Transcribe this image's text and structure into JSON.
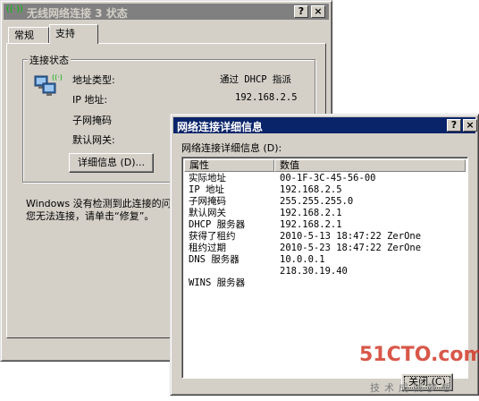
{
  "status_window": {
    "title": "无线网络连接 3 状态",
    "tabs": [
      "常规",
      "支持"
    ],
    "active_tab": "支持",
    "group_title": "连接状态",
    "fields": [
      {
        "label": "地址类型:",
        "value": "通过 DHCP 指派"
      },
      {
        "label": "IP 地址:",
        "value": "192.168.2.5"
      },
      {
        "label": "子网掩码",
        "value": ""
      },
      {
        "label": "默认网关:",
        "value": ""
      }
    ],
    "details_button": "详细信息 (D)...",
    "message_line1": "Windows 没有检测到此连接的问",
    "message_line2": "您无法连接，请单击“修复”。"
  },
  "details_dialog": {
    "title": "网络连接详细信息",
    "list_label": "网络连接详细信息 (D):",
    "columns": [
      "属性",
      "数值"
    ],
    "rows": [
      {
        "property": "实际地址",
        "value": "00-1F-3C-45-56-00"
      },
      {
        "property": "IP 地址",
        "value": "192.168.2.5"
      },
      {
        "property": "子网掩码",
        "value": "255.255.255.0"
      },
      {
        "property": "默认网关",
        "value": "192.168.2.1"
      },
      {
        "property": "DHCP 服务器",
        "value": "192.168.2.1"
      },
      {
        "property": "获得了租约",
        "value": "2010-5-13 18:47:22 ZerOne"
      },
      {
        "property": "租约过期",
        "value": "2010-5-23 18:47:22 ZerOne"
      },
      {
        "property": "DNS 服务器",
        "value": "10.0.0.1"
      },
      {
        "property": "",
        "value": "218.30.19.40"
      },
      {
        "property": "WINS 服务器",
        "value": ""
      }
    ],
    "close_button": "关闭 (C)"
  },
  "watermark": {
    "brand": "51CTO.com",
    "slogan": "技术成就梦想"
  },
  "colors": {
    "active_title": "#0a246a",
    "inactive_title": "#808080",
    "face": "#d4d0c8",
    "watermark_red": "#d23a2a"
  }
}
